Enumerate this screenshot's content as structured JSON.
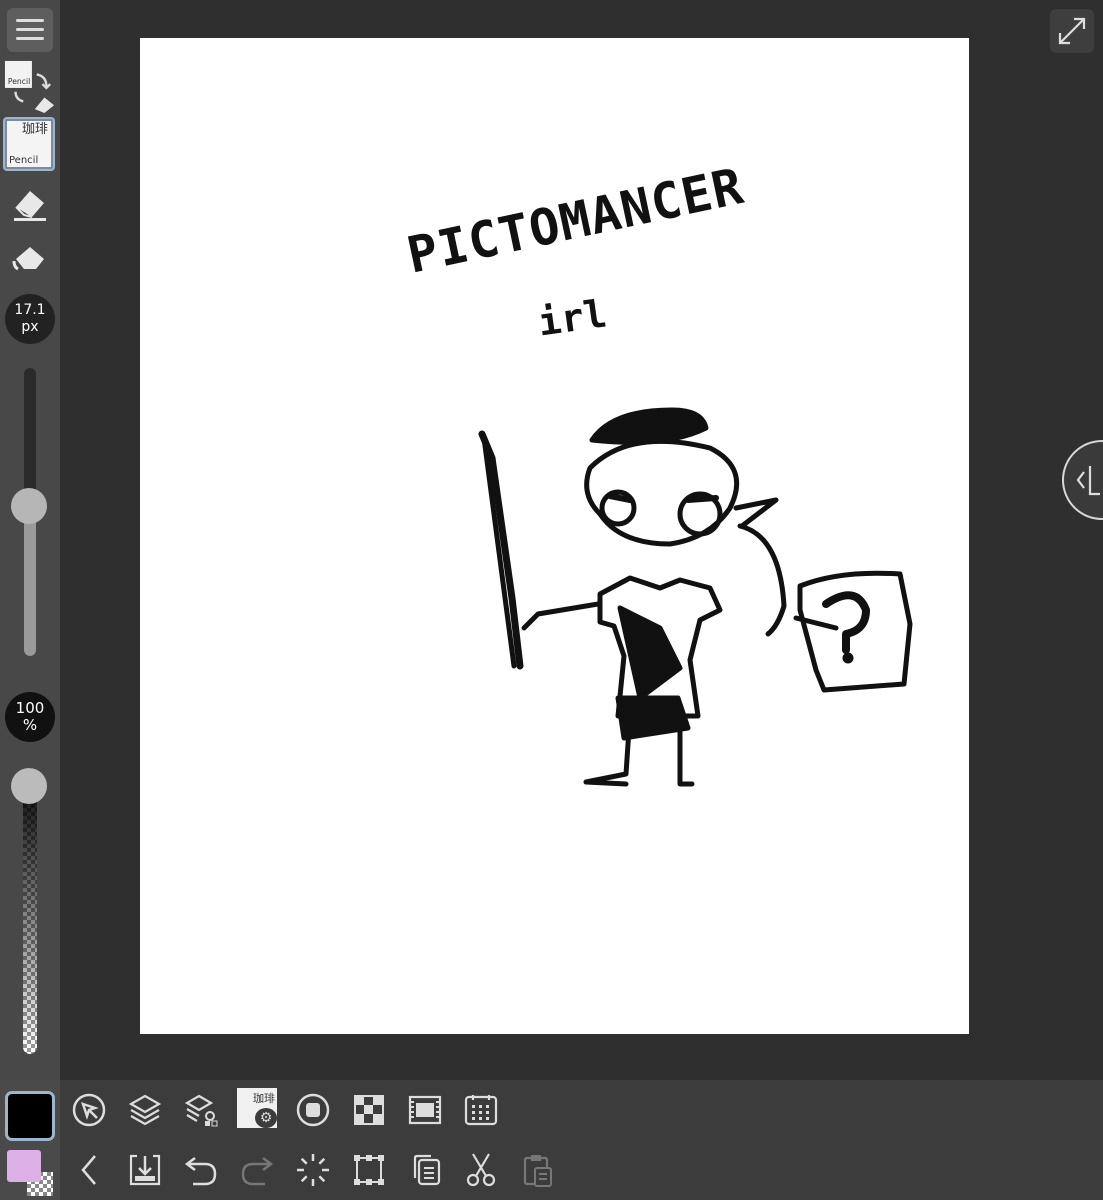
{
  "sidebar": {
    "brush_size": {
      "value": "17.1",
      "unit": "px",
      "level": 0.52
    },
    "opacity": {
      "value": "100",
      "unit": "%",
      "level": 1.0
    },
    "tool_thumb": {
      "kanji": "珈琲",
      "label": "Pencil"
    }
  },
  "canvas": {
    "drawing_text": [
      "PICTOMANCER",
      "irl"
    ]
  },
  "colors": {
    "main": "#000000",
    "sub": "#dcb0e6",
    "accent": "#9fb3c9"
  },
  "toolbar_top": {
    "icons": [
      "select-icon",
      "layers-icon",
      "layer-settings-icon",
      "brush-settings-icon",
      "material-icon",
      "filter-icon",
      "animation-icon",
      "grid-icon"
    ]
  },
  "toolbar_bottom": {
    "icons": [
      "back-icon",
      "save-icon",
      "undo-icon",
      "redo-icon",
      "loading-icon",
      "transform-icon",
      "copy-icon",
      "cut-icon",
      "paste-icon"
    ]
  }
}
